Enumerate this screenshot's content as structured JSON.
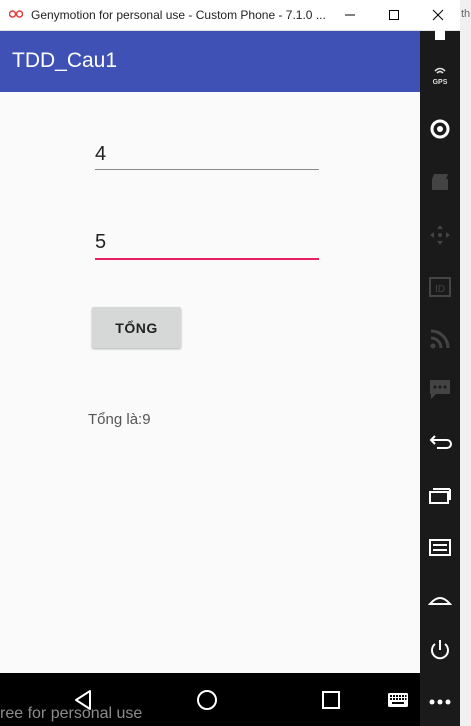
{
  "window": {
    "title": "Genymotion for personal use - Custom Phone - 7.1.0 ...",
    "background_edge_text": "th"
  },
  "app": {
    "title": "TDD_Cau1",
    "input1_value": "4",
    "input2_value": "5",
    "sum_button_label": "TỔNG",
    "result_text": "Tổng là:9"
  },
  "watermark": "ree for personal use",
  "colors": {
    "appbar": "#3f51b5",
    "focused_underline": "#e91e63",
    "button": "#d6d7d7",
    "sidebar": "#1a1a1a"
  },
  "sidebar_icons": [
    "battery-icon",
    "gps-icon",
    "webcam-icon",
    "capture-icon",
    "move-icon",
    "id-icon",
    "rss-icon",
    "sms-icon",
    "back-icon",
    "recent-apps-icon",
    "menu-icon",
    "home-icon",
    "power-icon",
    "more-icon"
  ]
}
